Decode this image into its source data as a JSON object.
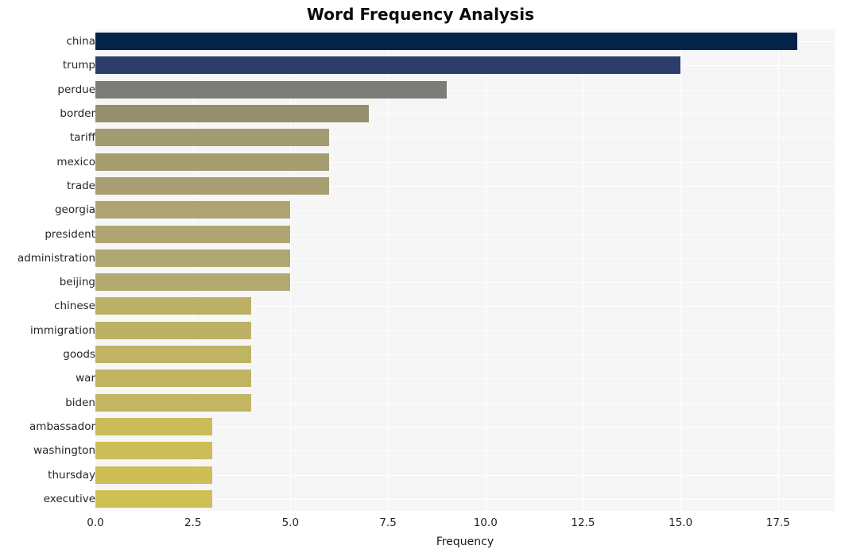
{
  "chart_data": {
    "type": "bar",
    "orientation": "horizontal",
    "title": "Word Frequency Analysis",
    "xlabel": "Frequency",
    "ylabel": "",
    "categories": [
      "china",
      "trump",
      "perdue",
      "border",
      "tariff",
      "mexico",
      "trade",
      "georgia",
      "president",
      "administration",
      "beijing",
      "chinese",
      "immigration",
      "goods",
      "war",
      "biden",
      "ambassador",
      "washington",
      "thursday",
      "executive"
    ],
    "values": [
      18,
      15,
      9,
      7,
      6,
      6,
      6,
      5,
      5,
      5,
      5,
      4,
      4,
      4,
      4,
      4,
      3,
      3,
      3,
      3
    ],
    "xlim": [
      0,
      18.95
    ],
    "xticks": [
      0.0,
      2.5,
      5.0,
      7.5,
      10.0,
      12.5,
      15.0,
      17.5
    ],
    "xticklabels": [
      "0.0",
      "2.5",
      "5.0",
      "7.5",
      "10.0",
      "12.5",
      "15.0",
      "17.5"
    ],
    "grid": true,
    "grid_color": "#ffffff",
    "legend": "none",
    "plot_background": "#f6f6f7",
    "figure_background": "#ffffff",
    "bar_colors": [
      "#032349",
      "#2c3c6b",
      "#7d7c78",
      "#958f6e",
      "#a29a71",
      "#a59d72",
      "#a79f72",
      "#ada472",
      "#aea572",
      "#b0a772",
      "#b2a973",
      "#bcb067",
      "#bdb166",
      "#bfb365",
      "#c0b463",
      "#c2b662",
      "#cbbc58",
      "#ccbd57",
      "#cdbe56",
      "#cfc055"
    ]
  }
}
